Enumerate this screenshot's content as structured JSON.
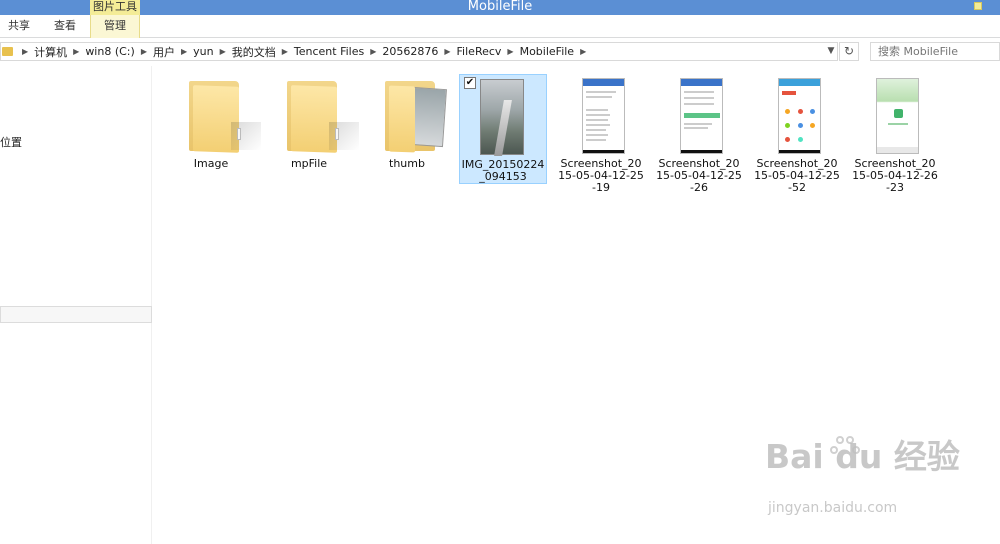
{
  "window": {
    "title": "MobileFile",
    "context_tab": "图片工具"
  },
  "ribbon": {
    "tabs": [
      {
        "label": "共享"
      },
      {
        "label": "查看"
      },
      {
        "label": "管理"
      }
    ]
  },
  "address": {
    "crumbs": [
      "计算机",
      "win8 (C:)",
      "用户",
      "yun",
      "我的文档",
      "Tencent Files",
      "20562876",
      "FileRecv",
      "MobileFile"
    ]
  },
  "search": {
    "placeholder": "搜索 MobileFile"
  },
  "nav": {
    "location_label": "位置"
  },
  "files": [
    {
      "name": "Image",
      "kind": "folder"
    },
    {
      "name": "mpFile",
      "kind": "folder"
    },
    {
      "name": "thumb",
      "kind": "folder-with-image"
    },
    {
      "name": "IMG_20150224_094153",
      "kind": "photo",
      "selected": true
    },
    {
      "name": "Screenshot_2015-05-04-12-25-19",
      "kind": "screenshot"
    },
    {
      "name": "Screenshot_2015-05-04-12-25-26",
      "kind": "screenshot"
    },
    {
      "name": "Screenshot_2015-05-04-12-25-52",
      "kind": "screenshot"
    },
    {
      "name": "Screenshot_2015-05-04-12-26-23",
      "kind": "screenshot"
    }
  ],
  "file_labels": {
    "image": "Image",
    "mpfile": "mpFile",
    "thumb": "thumb",
    "img": "IMG_20150224_094153",
    "s1": "Screenshot_2015-05-04-12-25-19",
    "s2": "Screenshot_2015-05-04-12-25-26",
    "s3": "Screenshot_2015-05-04-12-25-52",
    "s4": "Screenshot_2015-05-04-12-26-23"
  },
  "watermark": {
    "brand": "Bai du 经验",
    "url": "jingyan.baidu.com"
  },
  "colors": {
    "titlebar": "#5b8fd4",
    "context_tab": "#f4ec97",
    "selection": "#cce8ff",
    "folder": "#f3cf73"
  },
  "icons": {
    "refresh": "refresh-icon",
    "dropdown": "chevron-down-icon",
    "breadcrumb_separator": "chevron-right-icon"
  }
}
